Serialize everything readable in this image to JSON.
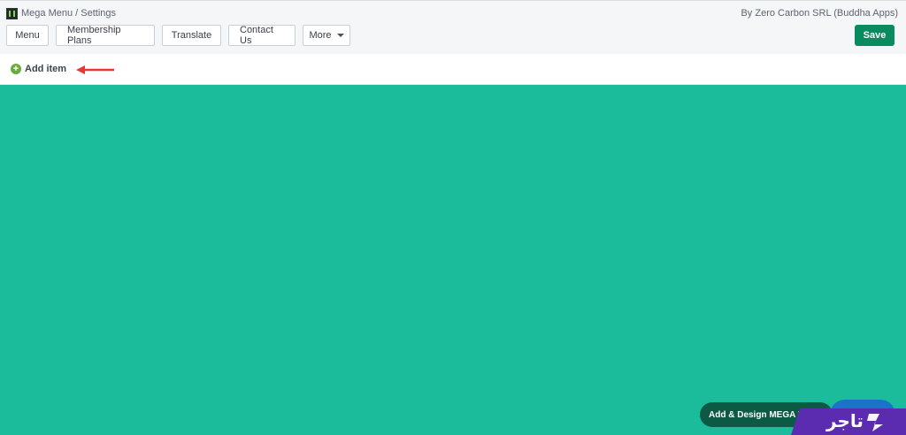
{
  "header": {
    "breadcrumb": "Mega Menu / Settings",
    "byline": "By Zero Carbon SRL (Buddha Apps)"
  },
  "tabs": [
    {
      "label": "Menu"
    },
    {
      "label": "Membership Plans"
    },
    {
      "label": "Translate"
    },
    {
      "label": "Contact Us"
    },
    {
      "label": "More"
    }
  ],
  "actions": {
    "save_label": "Save",
    "add_item_label": "Add item",
    "design_label": "Add & Design MEGA MENU"
  },
  "brand": {
    "text": "تاجر"
  },
  "colors": {
    "canvas": "#1bbc9b",
    "save": "#0a8a5f",
    "design_button": "#0d5a44",
    "brand_banner": "#5b2bb0",
    "annotation_arrow": "#e53935"
  },
  "icons": [
    "app-logo-icon",
    "chevron-down-icon",
    "plus-circle-icon",
    "arrow-left-icon"
  ]
}
